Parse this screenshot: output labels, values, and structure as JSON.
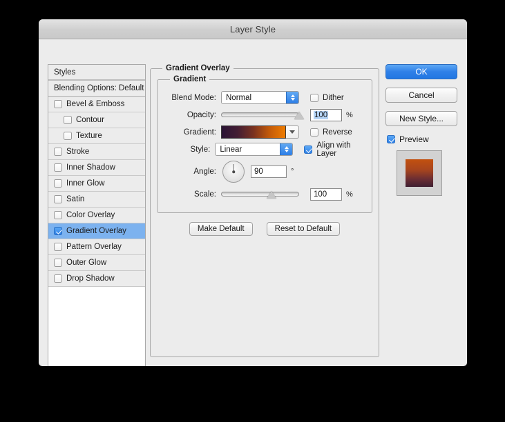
{
  "window": {
    "title": "Layer Style"
  },
  "sidebar": {
    "header": "Styles",
    "blending_options": "Blending Options: Default",
    "items": [
      {
        "label": "Bevel & Emboss",
        "checked": false,
        "indent": false,
        "selected": false
      },
      {
        "label": "Contour",
        "checked": false,
        "indent": true,
        "selected": false
      },
      {
        "label": "Texture",
        "checked": false,
        "indent": true,
        "selected": false
      },
      {
        "label": "Stroke",
        "checked": false,
        "indent": false,
        "selected": false
      },
      {
        "label": "Inner Shadow",
        "checked": false,
        "indent": false,
        "selected": false
      },
      {
        "label": "Inner Glow",
        "checked": false,
        "indent": false,
        "selected": false
      },
      {
        "label": "Satin",
        "checked": false,
        "indent": false,
        "selected": false
      },
      {
        "label": "Color Overlay",
        "checked": false,
        "indent": false,
        "selected": false
      },
      {
        "label": "Gradient Overlay",
        "checked": true,
        "indent": false,
        "selected": true
      },
      {
        "label": "Pattern Overlay",
        "checked": false,
        "indent": false,
        "selected": false
      },
      {
        "label": "Outer Glow",
        "checked": false,
        "indent": false,
        "selected": false
      },
      {
        "label": "Drop Shadow",
        "checked": false,
        "indent": false,
        "selected": false
      }
    ]
  },
  "panel": {
    "outer_legend": "Gradient Overlay",
    "inner_legend": "Gradient",
    "blend_mode": {
      "label": "Blend Mode:",
      "value": "Normal"
    },
    "dither": {
      "label": "Dither",
      "checked": false
    },
    "opacity": {
      "label": "Opacity:",
      "value": "100",
      "unit": "%",
      "percent": 100
    },
    "gradient": {
      "label": "Gradient:",
      "stops": [
        "#2a1435",
        "#431d33",
        "#7a3220",
        "#c35a09",
        "#ef7c00"
      ]
    },
    "reverse": {
      "label": "Reverse",
      "checked": false
    },
    "style": {
      "label": "Style:",
      "value": "Linear"
    },
    "align_with_layer": {
      "label": "Align with Layer",
      "checked": true
    },
    "angle": {
      "label": "Angle:",
      "value": "90",
      "unit": "°",
      "degrees": 90
    },
    "scale": {
      "label": "Scale:",
      "value": "100",
      "unit": "%",
      "percent": 65
    },
    "make_default": "Make Default",
    "reset_to_default": "Reset to Default"
  },
  "actions": {
    "ok": "OK",
    "cancel": "Cancel",
    "new_style": "New Style...",
    "preview": {
      "label": "Preview",
      "checked": true
    }
  },
  "colors": {
    "accent": "#2f80e8",
    "selection": "#7cb2ef",
    "dialog_bg": "#ececec",
    "thumb_top": "#c2510f",
    "thumb_bottom": "#3e1f31"
  }
}
